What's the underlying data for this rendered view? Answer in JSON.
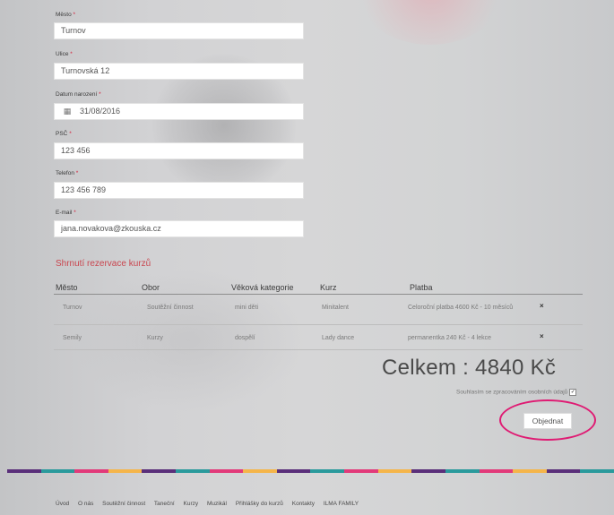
{
  "form": {
    "city": {
      "label": "Město",
      "value": "Turnov"
    },
    "street": {
      "label": "Ulice",
      "value": "Turnovská 12"
    },
    "birthdate": {
      "label": "Datum narození",
      "value": "31/08/2016"
    },
    "zip": {
      "label": "PSČ",
      "value": "123 456"
    },
    "phone": {
      "label": "Telefon",
      "value": "123 456 789"
    },
    "email": {
      "label": "E-mail",
      "value": "jana.novakova@zkouska.cz"
    },
    "required_mark": "*"
  },
  "summary": {
    "title": "Shrnutí rezervace kurzů",
    "headers": [
      "Město",
      "Obor",
      "Věková kategorie",
      "Kurz",
      "Platba"
    ],
    "rows": [
      {
        "city": "Turnov",
        "field": "Soutěžní činnost",
        "age": "mini děti",
        "course": "Minitalent",
        "payment": "Celoroční platba 4600 Kč - 10 měsíců"
      },
      {
        "city": "Semily",
        "field": "Kurzy",
        "age": "dospělí",
        "course": "Lady dance",
        "payment": "permanentka 240 Kč - 4 lekce"
      }
    ],
    "remove_glyph": "×"
  },
  "total": "Celkem : 4840 Kč",
  "consent": {
    "label": "Souhlasím se zpracováním osobních údajů",
    "checked": true,
    "mark": "✓"
  },
  "order_button": "Objednat",
  "stripe_colors": [
    "#5a2f7a",
    "#2a9a9c",
    "#e23a7a",
    "#f5b54a",
    "#5a2f7a",
    "#2a9a9c",
    "#e23a7a",
    "#f5b54a",
    "#5a2f7a",
    "#2a9a9c",
    "#e23a7a",
    "#f5b54a",
    "#5a2f7a",
    "#2a9a9c",
    "#e23a7a",
    "#f5b54a",
    "#5a2f7a",
    "#2a9a9c"
  ],
  "footer_nav": [
    "Úvod",
    "O nás",
    "Soutěžní činnost",
    "Taneční",
    "Kurzy",
    "Muzikál",
    "Přihlášky do kurzů",
    "Kontakty",
    "ILMA FAMILY"
  ]
}
